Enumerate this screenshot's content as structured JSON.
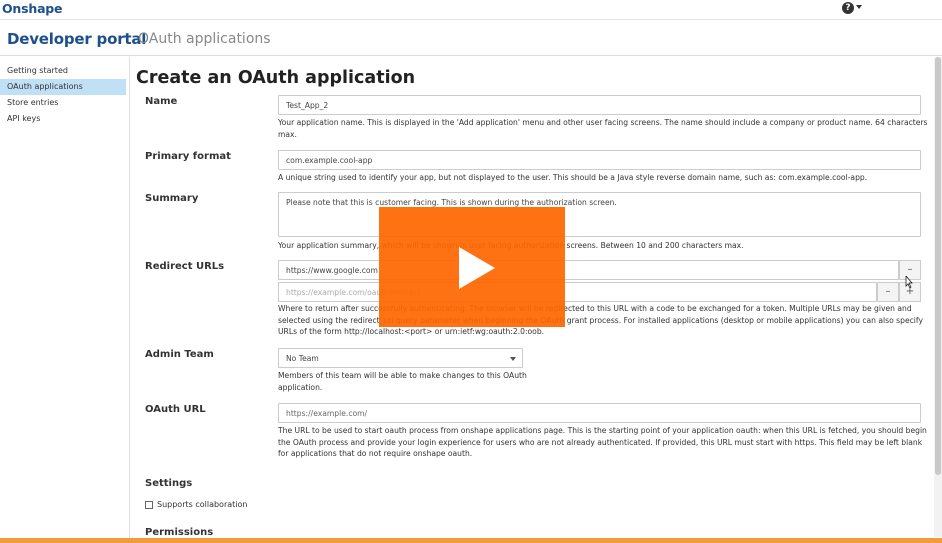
{
  "topbar": {
    "logo": "Onshape",
    "help_icon": "?"
  },
  "portal": {
    "title": "Developer portal",
    "section": "OAuth applications"
  },
  "sidebar": {
    "items": [
      {
        "label": "Getting started",
        "active": false
      },
      {
        "label": "OAuth applications",
        "active": true
      },
      {
        "label": "Store entries",
        "active": false
      },
      {
        "label": "API keys",
        "active": false
      }
    ]
  },
  "form": {
    "heading": "Create an OAuth application",
    "name": {
      "label": "Name",
      "value": "Test_App_2",
      "help1": "Your application name. This is displayed in the 'Add application' menu and other user facing screens. The name should include a company or product name. 64 characters",
      "help2": "max."
    },
    "primary_format": {
      "label": "Primary format",
      "value": "com.example.cool-app",
      "help": "A unique string used to identify your app, but not displayed to the user. This should be a Java style reverse domain name, such as: com.example.cool-app."
    },
    "summary": {
      "label": "Summary",
      "value": "Please note that this is customer facing. This is shown during the authorization screen.",
      "help": "Your application summary, which will be shown in user facing authorization screens. Between 10 and 200 characters max."
    },
    "redirect": {
      "label": "Redirect URLs",
      "url1": "https://www.google.com",
      "url2_placeholder": "https://example.com/oauthRedirect",
      "add_label": "+",
      "remove_label": "–",
      "help1": "Where to return after successfully authenticating. The browser will be redirected to this URL with a code to be exchanged for a token. Multiple URLs may be given and",
      "help2": "selected using the redirect_uri query parameter when beginning the OAuth grant process. For installed applications (desktop or mobile applications) you can also specify",
      "help3": "URLs of the form http://localhost:<port> or urn:ietf:wg:oauth:2.0:oob."
    },
    "admin_team": {
      "label": "Admin Team",
      "value": "No Team",
      "help1": "Members of this team will be able to make changes to this OAuth",
      "help2": "application."
    },
    "oauth_url": {
      "label": "OAuth URL",
      "placeholder": "https://example.com/",
      "help1": "The URL to be used to start oauth process from onshape applications page. This is the starting point of your application oauth: when this URL is fetched, you should begin",
      "help2": "the OAuth process and provide your login experience for users who are not already authenticated. If provided, this URL must start with https. This field may be left blank",
      "help3": "for applications that do not require onshape oauth."
    },
    "settings": {
      "label": "Settings",
      "checkbox_label": "Supports collaboration"
    },
    "permissions": {
      "label": "Permissions"
    }
  },
  "video": {
    "play_icon": "play-icon",
    "color": "#ff6600"
  }
}
